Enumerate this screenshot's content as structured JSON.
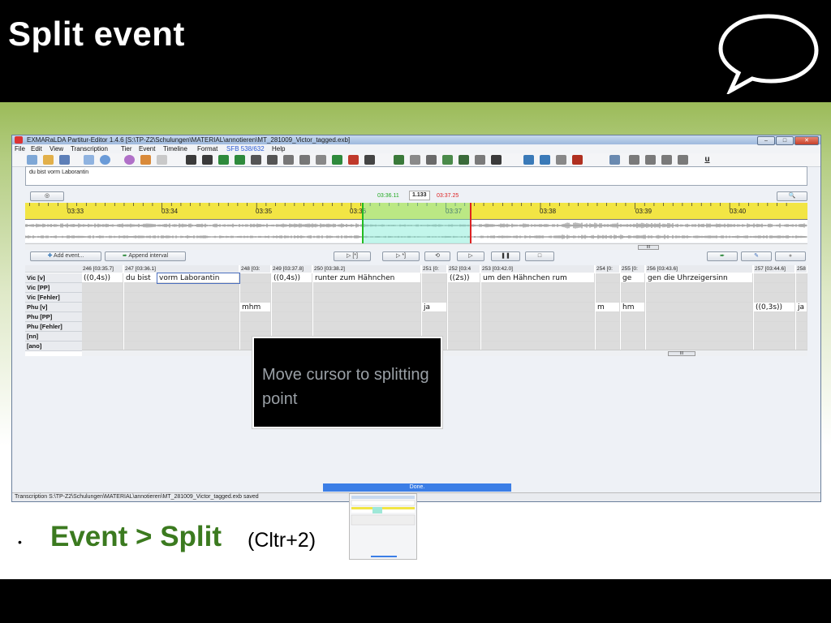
{
  "slide": {
    "title": "Split event",
    "bullet": {
      "main": "Event > Split",
      "shortcut": "(Cltr+2)"
    },
    "callout": "Move cursor to splitting point"
  },
  "app": {
    "window_title": "EXMARaLDA Partitur-Editor 1.4.6 [S:\\TP-Z2\\Schulungen\\MATERIAL\\annotieren\\MT_281009_Victor_tagged.exb]",
    "menu": [
      "File",
      "Edit",
      "View",
      "Transcription",
      "Tier",
      "Event",
      "Timeline",
      "Format",
      "SFB 538/632",
      "Help"
    ],
    "text_area": "du bist vorm Laborantin",
    "selection": {
      "start": "03:36.11",
      "duration": "1.133",
      "end": "03:37.25"
    },
    "ruler_labels": [
      "03:33",
      "03:34",
      "03:35",
      "03:36",
      "03:37",
      "03:38",
      "03:39",
      "03:40"
    ],
    "buttons": {
      "add_event": "Add event...",
      "append_interval": "Append interval",
      "play_sel1": "▷ [*]",
      "play_sel2": "▷ *]"
    },
    "partitur": {
      "columns": [
        "246 [03:35.7]",
        "247 [03:36.1]",
        "248 [03:",
        "249 [03:37.8]",
        "250 [03:38.2]",
        "251 [0:",
        "252 [03:4",
        "253 [03:42.0]",
        "254 [0:",
        "255 [0:",
        "256 [03:43.6]",
        "257 [03:44.6]",
        "258"
      ],
      "tiers": [
        "Vic [v]",
        "Vic [PP]",
        "Vic [Fehler]",
        "Phu [v]",
        "Phu [PP]",
        "Phu [Fehler]",
        "[nn]",
        "[ano]"
      ],
      "vic_v": [
        "((0,4s))",
        "du bist",
        "vorm Laborantin",
        "((0,4s))",
        "runter zum Hähnchen",
        "((2s))",
        "um den Hähnchen rum",
        "ge",
        "gen die Uhrzeigersinn"
      ],
      "phu_v": [
        "mhm",
        "ja",
        "m",
        "hm",
        "((0,3s))",
        "ja"
      ]
    },
    "progress": "Done.",
    "status": "Transcription S:\\TP-Z2\\Schulungen\\MATERIAL\\annotieren\\MT_281009_Victor_tagged.exb saved"
  },
  "colors": {
    "title_green": "#3b7a1f",
    "ruler_yellow": "#f2e544",
    "selection_start": "#22aa22",
    "selection_end": "#dd2222"
  }
}
